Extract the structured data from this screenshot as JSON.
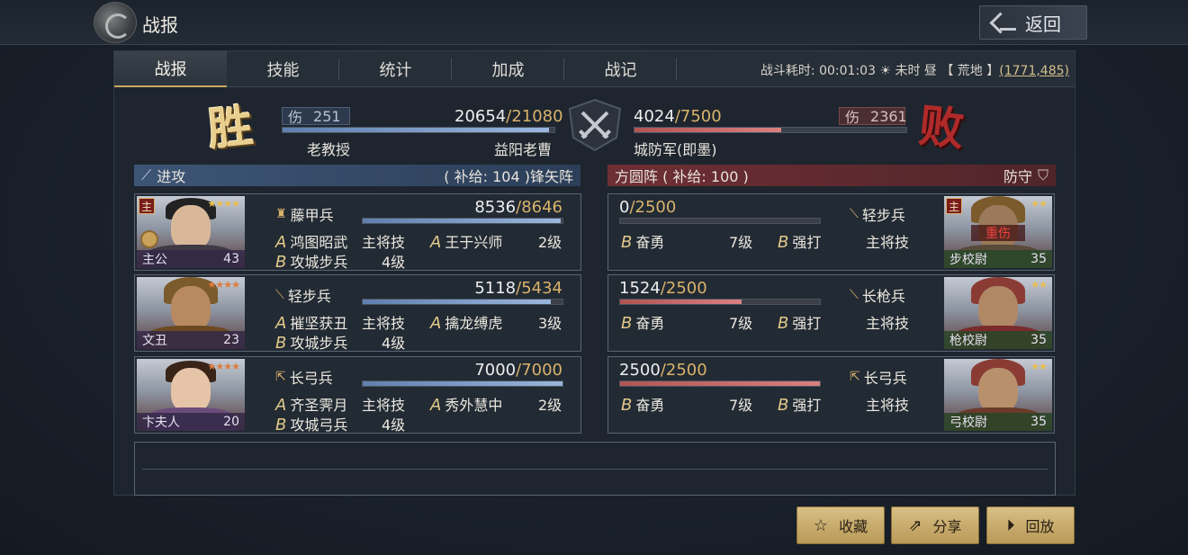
{
  "header": {
    "title": "战报",
    "back_label": "返回"
  },
  "tabs": [
    {
      "label": "战报",
      "active": true
    },
    {
      "label": "技能"
    },
    {
      "label": "统计"
    },
    {
      "label": "加成"
    },
    {
      "label": "战记"
    }
  ],
  "battle_info": {
    "prefix": "战斗耗时:",
    "duration": "00:01:03",
    "time_of_day": "未时 昼",
    "terrain": "【 荒地 】",
    "coord": "(1771,485)"
  },
  "summary": {
    "win_char": "胜",
    "lose_char": "败",
    "left": {
      "dmg_label": "伤",
      "dmg": "251",
      "troops": "20654",
      "troops_max": "/21080",
      "commander": "老教授",
      "city": "益阳老曹",
      "fraction": 0.98
    },
    "right": {
      "dmg_label": "伤",
      "dmg": "2361",
      "troops": "4024",
      "troops_max": "/7500",
      "name": "城防军(即墨)",
      "fraction": 0.54
    }
  },
  "attack_section": {
    "label": "进攻",
    "supply": "( 补给: 104 )",
    "formation": "锋矢阵"
  },
  "defense_section": {
    "label": "方圆阵 ( 补给: 100 )",
    "side": "防守"
  },
  "attackers": [
    {
      "name": "主公",
      "level": "43",
      "lord": "主",
      "troop_type": "藤甲兵",
      "hp": "8536",
      "hp_max": "/8646",
      "fraction": 0.99,
      "skills": [
        {
          "letter": "A",
          "name": "鸿图昭武",
          "info": "主将技"
        },
        {
          "letter": "A",
          "name": "王于兴师",
          "info": "2级"
        },
        {
          "letter": "B",
          "name": "攻城步兵",
          "info": "4级"
        }
      ]
    },
    {
      "name": "文丑",
      "level": "23",
      "troop_type": "轻步兵",
      "hp": "5118",
      "hp_max": "/5434",
      "fraction": 0.94,
      "skills": [
        {
          "letter": "A",
          "name": "摧坚获丑",
          "info": "主将技"
        },
        {
          "letter": "A",
          "name": "擒龙缚虎",
          "info": "3级"
        },
        {
          "letter": "B",
          "name": "攻城步兵",
          "info": "4级"
        }
      ]
    },
    {
      "name": "卞夫人",
      "level": "20",
      "troop_type": "长弓兵",
      "hp": "7000",
      "hp_max": "/7000",
      "fraction": 1.0,
      "skills": [
        {
          "letter": "A",
          "name": "齐圣霁月",
          "info": "主将技"
        },
        {
          "letter": "A",
          "name": "秀外慧中",
          "info": "2级"
        },
        {
          "letter": "B",
          "name": "攻城弓兵",
          "info": "4级"
        }
      ]
    }
  ],
  "defenders": [
    {
      "name": "步校尉",
      "level": "35",
      "lord": "主",
      "status": "重伤",
      "troop_type": "轻步兵",
      "hp": "0",
      "hp_max": "/2500",
      "fraction": 0.0,
      "skills": [
        {
          "letter": "B",
          "name": "奋勇",
          "info": "7级"
        },
        {
          "letter": "B",
          "name": "强打",
          "info": "主将技"
        }
      ]
    },
    {
      "name": "枪校尉",
      "level": "35",
      "troop_type": "长枪兵",
      "hp": "1524",
      "hp_max": "/2500",
      "fraction": 0.61,
      "skills": [
        {
          "letter": "B",
          "name": "奋勇",
          "info": "7级"
        },
        {
          "letter": "B",
          "name": "强打",
          "info": "主将技"
        }
      ]
    },
    {
      "name": "弓校尉",
      "level": "35",
      "troop_type": "长弓兵",
      "hp": "2500",
      "hp_max": "/2500",
      "fraction": 1.0,
      "skills": [
        {
          "letter": "B",
          "name": "奋勇",
          "info": "7级"
        },
        {
          "letter": "B",
          "name": "强打",
          "info": "主将技"
        }
      ]
    }
  ],
  "buttons": {
    "collect": "收藏",
    "share": "分享",
    "replay": "回放"
  }
}
